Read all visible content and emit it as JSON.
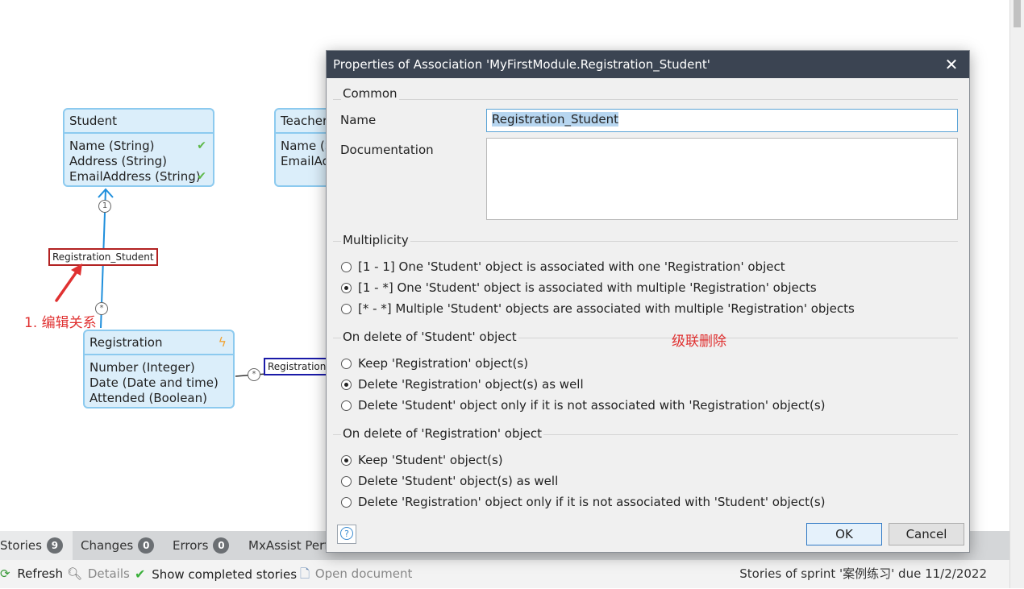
{
  "canvas": {
    "entities": {
      "student": {
        "name": "Student",
        "attributes": [
          "Name (String)",
          "Address (String)",
          "EmailAddress (String)"
        ]
      },
      "teacher": {
        "name": "Teacher",
        "attributes": [
          "Name (S",
          "EmailAdd"
        ]
      },
      "registration": {
        "name": "Registration",
        "attributes": [
          "Number (Integer)",
          "Date (Date and time)",
          "Attended (Boolean)"
        ]
      }
    },
    "associations": {
      "registration_student": "Registration_Student",
      "registration_other": "Registration"
    },
    "multiplicity_markers": {
      "one": "1",
      "many": "*"
    },
    "annotations": {
      "edit_relation": "1. 编辑关系",
      "cascade_delete": "级联删除"
    },
    "colors": {
      "annotation_red": "#e03131",
      "entity_border": "#8ccaef"
    }
  },
  "dialog": {
    "title": "Properties of Association 'MyFirstModule.Registration_Student'",
    "common": {
      "group_title": "Common",
      "name_label": "Name",
      "name_value": "Registration_Student",
      "documentation_label": "Documentation",
      "documentation_value": ""
    },
    "multiplicity": {
      "group_title": "Multiplicity",
      "options": [
        "[1 - 1] One 'Student' object is associated with one 'Registration' object",
        "[1 - *] One 'Student' object is associated with multiple 'Registration' objects",
        "[* - *] Multiple 'Student' objects are associated with multiple 'Registration' objects"
      ],
      "selected_index": 1
    },
    "on_delete_student": {
      "group_title": "On delete of 'Student' object",
      "options": [
        "Keep 'Registration' object(s)",
        "Delete 'Registration' object(s) as well",
        "Delete 'Student' object only if it is not associated with 'Registration' object(s)"
      ],
      "selected_index": 1
    },
    "on_delete_registration": {
      "group_title": "On delete of 'Registration' object",
      "options": [
        "Keep 'Student' object(s)",
        "Delete 'Student' object(s) as well",
        "Delete 'Registration' object only if it is not associated with 'Student' object(s)"
      ],
      "selected_index": 0
    },
    "buttons": {
      "ok": "OK",
      "cancel": "Cancel",
      "help": "?"
    }
  },
  "bottom_panel": {
    "tabs": [
      {
        "label": "Stories",
        "count": "9"
      },
      {
        "label": "Changes",
        "count": "0"
      },
      {
        "label": "Errors",
        "count": "0"
      },
      {
        "label": "MxAssist Perf",
        "count": ""
      }
    ],
    "toolbar": {
      "refresh": "Refresh",
      "details": "Details",
      "show_completed": "Show completed stories",
      "open_document": "Open document",
      "sprint_info": "Stories of sprint '案例练习' due 11/2/2022"
    }
  }
}
